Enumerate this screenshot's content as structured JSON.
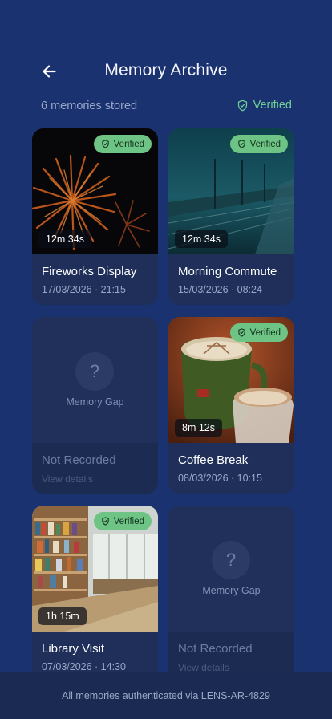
{
  "header": {
    "title": "Memory Archive",
    "back_icon": "arrow-left-icon"
  },
  "summary": {
    "count_text": "6 memories stored",
    "verified_label": "Verified",
    "verified_icon": "shield-check-icon"
  },
  "cards": [
    {
      "name": "Fireworks Display",
      "date": "17/03/2026 · 21:15",
      "duration": "12m 34s",
      "badge": "Verified"
    },
    {
      "name": "Morning Commute",
      "date": "15/03/2026 · 08:24",
      "duration": "12m 34s",
      "badge": "Verified"
    },
    {
      "gap_label": "Memory Gap",
      "name": "Not Recorded",
      "link": "View details",
      "icon": "question-icon"
    },
    {
      "name": "Coffee Break",
      "date": "08/03/2026 · 10:15",
      "duration": "8m 12s",
      "badge": "Verified"
    },
    {
      "name": "Library Visit",
      "date": "07/03/2026 · 14:30",
      "duration": "1h 15m",
      "badge": "Verified"
    },
    {
      "gap_label": "Memory Gap",
      "name": "Not Recorded",
      "link": "View details",
      "icon": "question-icon"
    }
  ],
  "footer": {
    "text": "All memories authenticated via LENS-AR-4829"
  },
  "colors": {
    "background": "#1b3270",
    "card": "#1f2f5a",
    "verified": "#6ec485",
    "verified_text": "#6fcf97"
  }
}
